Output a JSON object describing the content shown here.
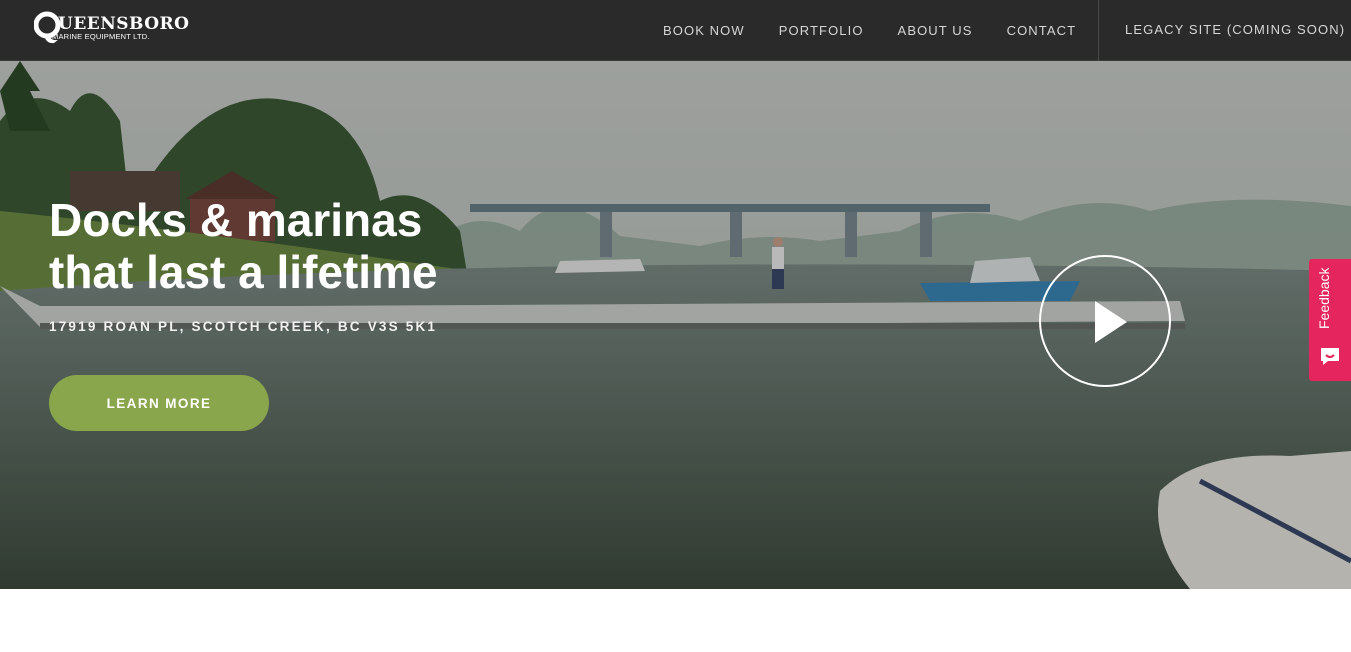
{
  "brand": {
    "logo_main": "UEENSBORO",
    "logo_sub": "MARINE EQUIPMENT LTD."
  },
  "nav": {
    "items": [
      {
        "label": "BOOK NOW"
      },
      {
        "label": "PORTFOLIO"
      },
      {
        "label": "ABOUT US"
      },
      {
        "label": "CONTACT"
      }
    ],
    "legacy_label": "LEGACY SITE (COMING SOON)"
  },
  "hero": {
    "title_line1": "Docks & marinas",
    "title_line2": "that last a lifetime",
    "address": "17919 ROAN PL, SCOTCH CREEK, BC V3S 5K1",
    "cta_label": "LEARN MORE",
    "play_icon": "play-icon"
  },
  "feedback": {
    "label": "Feedback",
    "icon": "smiley-chat-icon"
  },
  "colors": {
    "navbar": "#2a2a2a",
    "cta": "#8aa64d",
    "feedback": "#e5255d"
  }
}
